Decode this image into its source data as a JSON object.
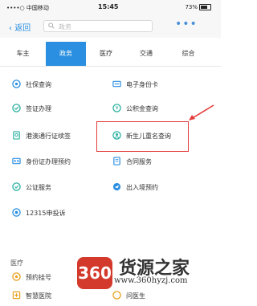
{
  "status": {
    "carrier": "••••○ 中国移动",
    "time": "15:45",
    "battery": "73%"
  },
  "nav": {
    "back_label": "返回",
    "search_placeholder": "政务",
    "more": "•••"
  },
  "tabs": [
    {
      "label": "车主",
      "active": false
    },
    {
      "label": "政务",
      "active": true
    },
    {
      "label": "医疗",
      "active": false
    },
    {
      "label": "交通",
      "active": false
    },
    {
      "label": "综合",
      "active": false
    }
  ],
  "services": [
    {
      "label": "社保查询",
      "icon": "shield-icon",
      "color": "#2a8fe0"
    },
    {
      "label": "电子身份卡",
      "icon": "id-card-icon",
      "color": "#2a8fe0"
    },
    {
      "label": "签证办理",
      "icon": "visa-icon",
      "color": "#2ab0a0"
    },
    {
      "label": "公积金查询",
      "icon": "coin-icon",
      "color": "#2ab0a0"
    },
    {
      "label": "港澳通行证续签",
      "icon": "passport-icon",
      "color": "#2ab0a0"
    },
    {
      "label": "新生儿重名查询",
      "icon": "baby-icon",
      "color": "#2ab0a0"
    },
    {
      "label": "身份证办理预约",
      "icon": "idcard-appointment-icon",
      "color": "#2a8fe0"
    },
    {
      "label": "合同服务",
      "icon": "contract-icon",
      "color": "#2a8fe0"
    },
    {
      "label": "公证服务",
      "icon": "notary-icon",
      "color": "#2ab0a0"
    },
    {
      "label": "出入境预约",
      "icon": "immigration-icon",
      "color": "#2a8fe0"
    },
    {
      "label": "12315申投诉",
      "icon": "complaint-icon",
      "color": "#2a8fe0"
    }
  ],
  "section_medical": {
    "title": "医疗",
    "items": [
      {
        "label": "预约挂号",
        "icon": "registration-icon",
        "color": "#e8a020"
      },
      {
        "label": "智慧医院",
        "icon": "hospital-icon",
        "color": "#e8a020"
      },
      {
        "label": "问医生",
        "icon": "doctor-icon",
        "color": "#e8a020"
      }
    ]
  },
  "watermark": {
    "logo": "360",
    "brand": "货源之家",
    "url": "www.360hyzj.com"
  },
  "colors": {
    "accent": "#2a8fe0",
    "highlight": "#e43c3c"
  }
}
